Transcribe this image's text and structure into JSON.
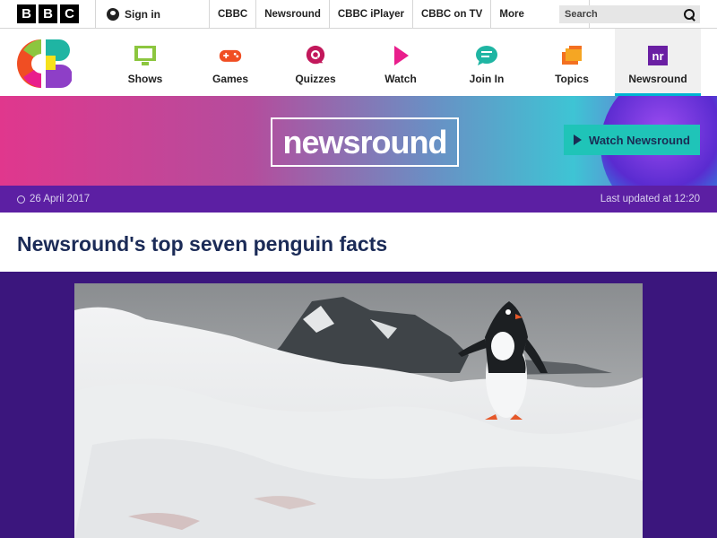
{
  "bbc": {
    "logo_letters": [
      "B",
      "B",
      "C"
    ],
    "signin": "Sign in",
    "links": [
      "CBBC",
      "Newsround",
      "CBBC iPlayer",
      "CBBC on TV"
    ],
    "more": "More",
    "search_placeholder": "Search"
  },
  "cbbc_nav": {
    "items": [
      {
        "label": "Shows",
        "icon": "tv-icon",
        "color": "#8cc63f"
      },
      {
        "label": "Games",
        "icon": "gamepad-icon",
        "color": "#f04e23"
      },
      {
        "label": "Quizzes",
        "icon": "quiz-icon",
        "color": "#c2185b"
      },
      {
        "label": "Watch",
        "icon": "play-icon",
        "color": "#e91e8c"
      },
      {
        "label": "Join In",
        "icon": "chat-icon",
        "color": "#1fb5a3"
      },
      {
        "label": "Topics",
        "icon": "cards-icon",
        "color": "#f37021"
      },
      {
        "label": "Newsround",
        "icon": "newsround-icon",
        "color": "#6a1fa3"
      }
    ],
    "newsround_icon_text": "nr"
  },
  "banner": {
    "logo_text": "newsround",
    "watch_button": "Watch Newsround"
  },
  "article": {
    "date": "26 April 2017",
    "last_updated": "Last updated at 12:20",
    "headline": "Newsround's top seven penguin facts"
  }
}
